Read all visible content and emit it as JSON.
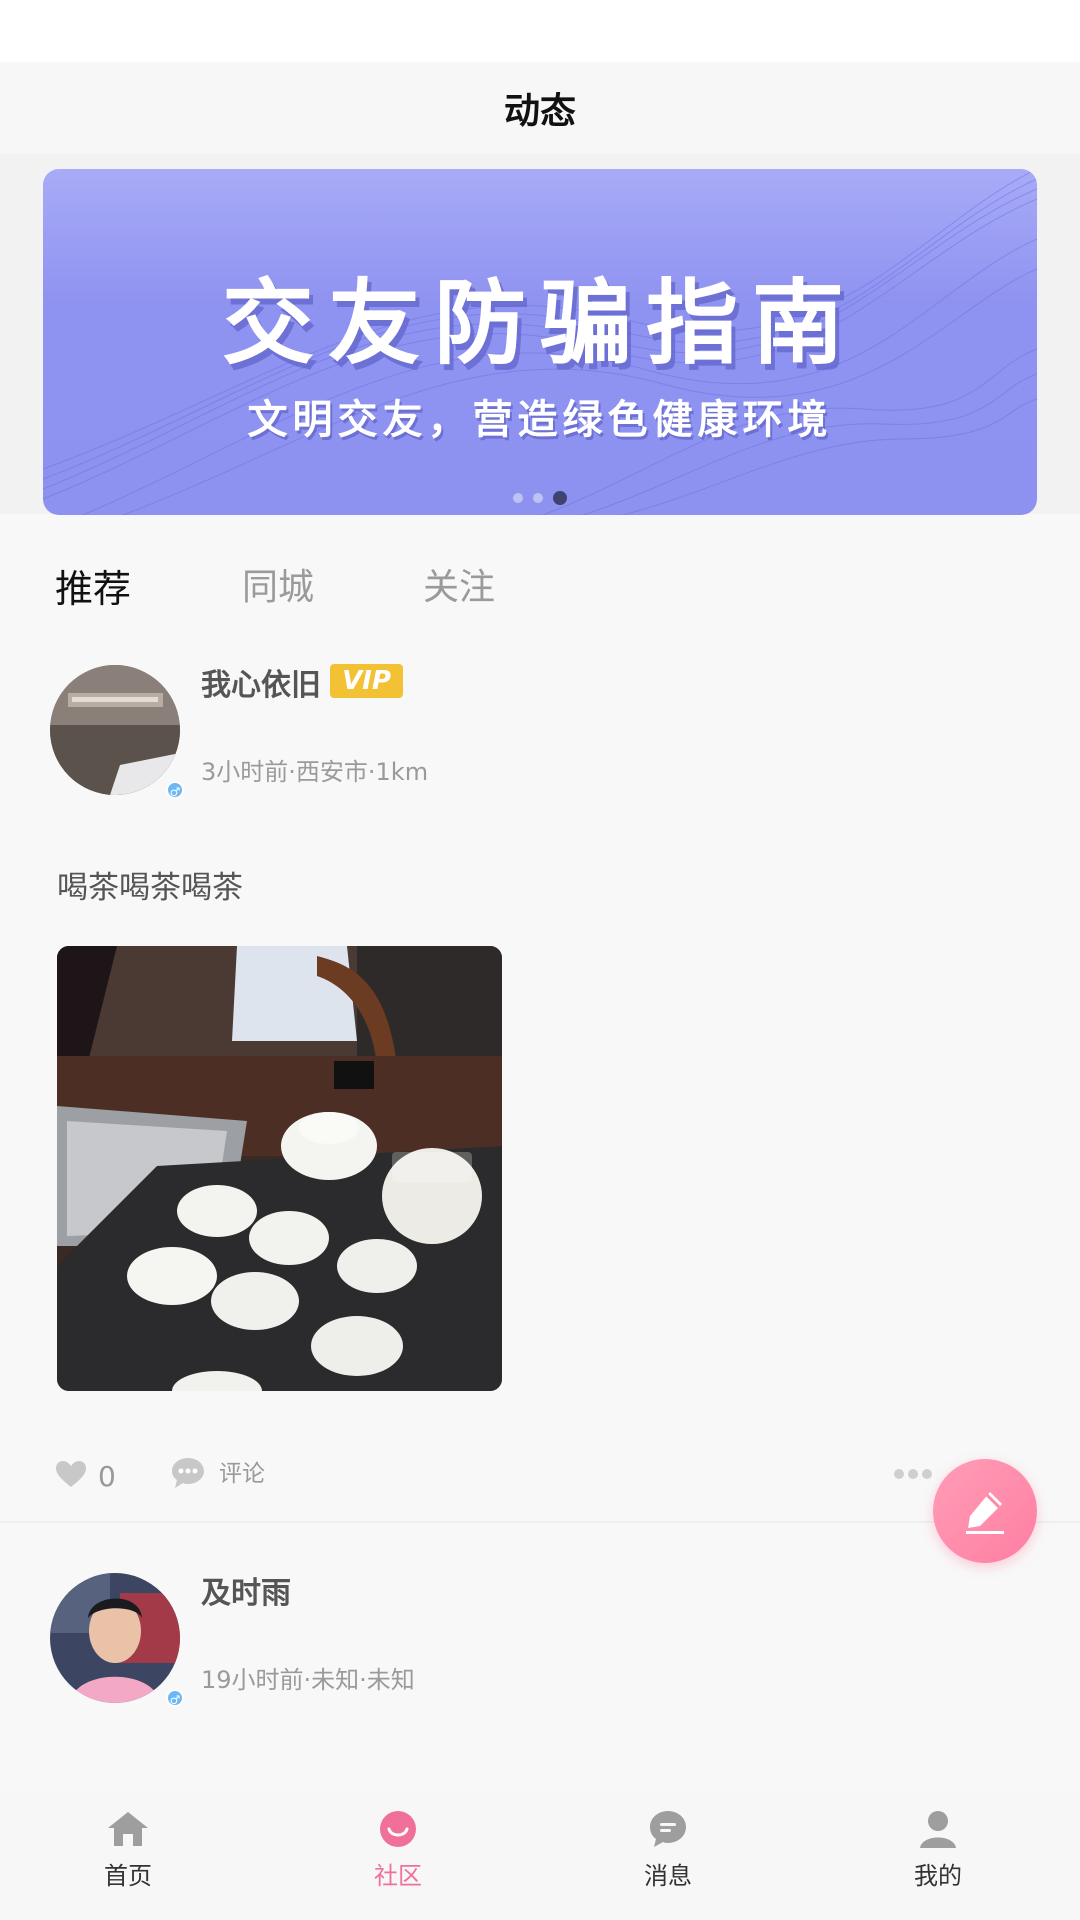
{
  "header": {
    "title": "动态"
  },
  "banner": {
    "title": "交友防骗指南",
    "subtitle": "文明交友，营造绿色健康环境",
    "slide_count": 3,
    "active_slide": 3
  },
  "tabs": [
    {
      "label": "推荐",
      "active": true
    },
    {
      "label": "同城",
      "active": false
    },
    {
      "label": "关注",
      "active": false
    }
  ],
  "posts": [
    {
      "username": "我心依旧",
      "vip_badge": "VIP",
      "meta": "3小时前·西安市·1km",
      "gender_icon": "male-icon",
      "text": "喝茶喝茶喝茶",
      "likes": "0",
      "comment_label": "评论"
    },
    {
      "username": "及时雨",
      "meta": "19小时前·未知·未知",
      "gender_icon": "male-icon"
    }
  ],
  "fab": {
    "icon": "edit-pen-icon"
  },
  "bottom_nav": [
    {
      "label": "首页",
      "icon": "home-icon",
      "active": false
    },
    {
      "label": "社区",
      "icon": "community-icon",
      "active": true
    },
    {
      "label": "消息",
      "icon": "message-icon",
      "active": false
    },
    {
      "label": "我的",
      "icon": "profile-icon",
      "active": false
    }
  ],
  "colors": {
    "accent": "#f0709a",
    "banner": "#8e92f0",
    "vip": "#f3c234",
    "gender_male": "#6cb8f4"
  }
}
